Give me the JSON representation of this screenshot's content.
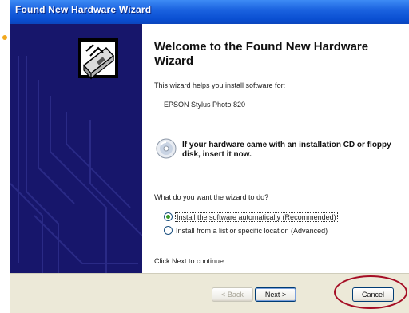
{
  "window": {
    "title": "Found New Hardware Wizard"
  },
  "wizard": {
    "heading": "Welcome to the Found New Hardware Wizard",
    "intro": "This wizard helps you install software for:",
    "device_name": "EPSON Stylus Photo 820",
    "cd_prompt": "If your hardware came with an installation CD or floppy disk, insert it now.",
    "question": "What do you want the wizard to do?",
    "options": [
      {
        "label": "Install the software automatically (Recommended)",
        "selected": true
      },
      {
        "label": "Install from a list or specific location (Advanced)",
        "selected": false
      }
    ],
    "continue_hint": "Click Next to continue."
  },
  "buttons": {
    "back": "< Back",
    "next": "Next >",
    "cancel": "Cancel"
  },
  "icons": {
    "wizard_graphic": "hardware-installer-icon",
    "cd": "cd-disc-icon"
  },
  "colors": {
    "titlebar": "#0a4fd2",
    "side_panel": "#17166b",
    "highlight": "#a50d24"
  }
}
